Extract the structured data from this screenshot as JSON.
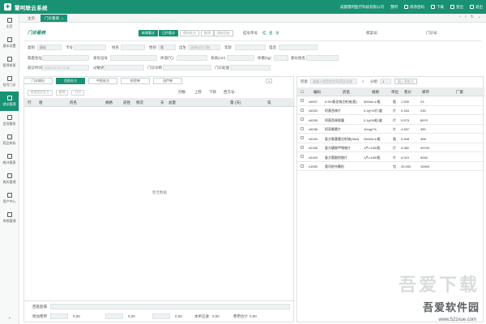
{
  "app": {
    "name": "慧呵联云系统"
  },
  "topbar": {
    "clinic": "成都慧呵医疗科技有限公司",
    "user": "慧呵",
    "modify_pwd": "修改密码",
    "download": "下载",
    "logout": "登出",
    "unread": "退出"
  },
  "sidebar": {
    "items": [
      {
        "label": "主页",
        "icon": "home-icon"
      },
      {
        "label": "基本设置",
        "icon": "gear-icon"
      },
      {
        "label": "医师排班",
        "icon": "calendar-icon"
      },
      {
        "label": "挂号门诊",
        "icon": "clipboard-icon"
      },
      {
        "label": "就诊管理",
        "icon": "person-icon"
      },
      {
        "label": "会员服务",
        "icon": "user-group-icon"
      },
      {
        "label": "药品库存",
        "icon": "pill-icon"
      },
      {
        "label": "统计报表",
        "icon": "chart-icon"
      },
      {
        "label": "病历管理",
        "icon": "folder-icon"
      },
      {
        "label": "用户中心",
        "icon": "user-icon"
      },
      {
        "label": "系统管理",
        "icon": "monitor-icon"
      }
    ],
    "collapse": "»"
  },
  "tabs": [
    {
      "label": "主页"
    },
    {
      "label": "门诊看病"
    }
  ],
  "header": {
    "title": "门诊看病",
    "buttons": [
      "新增看诊",
      "已约看诊",
      "保存处方",
      "取消",
      "保存历史"
    ],
    "reg_no_label": "挂号单号",
    "reg_btn": "挂",
    "query": "查",
    "visit_label": "访",
    "pat_no_label": "病案号:",
    "outpatient_no_label": "门诊号:"
  },
  "form": {
    "type_label": "类别",
    "type_value": "初诊",
    "card_label": "卡号",
    "name_label": "姓名",
    "gender_label": "性别",
    "gender_value": "男",
    "birth_label": "出生",
    "birth_placeholder": "选择出生日期",
    "age_label": "年龄",
    "phone_label": "电话",
    "addr_label": "家庭住址",
    "id_label": "身份证号",
    "temp_label": "体温(℃)",
    "height_label": "身高(cm)",
    "weight_label": "体重(kg)",
    "family_label": "家长姓名",
    "date_label": "就诊时间",
    "date_value": "2022-07-22 11:09",
    "history_label": "过敏史",
    "dept_label": "门诊诊断",
    "treat_label": "门诊处理"
  },
  "rx_tabs": [
    "门诊病历",
    "西医处方",
    "中医处方",
    "检验单",
    "治疗单"
  ],
  "rx_sub": {
    "btns": [
      "新增西药处方",
      "删除",
      "打印"
    ],
    "copies_label": "剂数",
    "up": "上移",
    "down": "下移",
    "rx_no_label": "西方号:"
  },
  "left_table": {
    "columns": [
      "行",
      "组",
      "药名",
      "规格",
      "途径",
      "频次",
      "天",
      "总量",
      "量",
      "(天)",
      "说"
    ],
    "empty": "暂无数据"
  },
  "left_footer": {
    "wm_label": "西医医嘱",
    "extra_label": "附加费用",
    "extra_value": "0.00",
    "v2": "0.00",
    "v3": "0.00",
    "fee_label": "本单应收",
    "fee_value": "0.00",
    "total_label": "费用合计",
    "total_value": "0.00"
  },
  "right_search": {
    "label": "检索",
    "placeholder": "请输入拼音首字母/药品名称",
    "count_label": "分组",
    "count_value": "1",
    "add_btn": "插入到处方"
  },
  "right_table": {
    "columns": [
      "",
      "编码",
      "药名",
      "规格",
      "单位",
      "售价",
      "库存",
      "厂家"
    ],
    "rows": [
      {
        "code": "x0007",
        "name": "0.9%氯化钠注射液(瓶)",
        "spec": "500ml×1/瓶",
        "unit": "瓶",
        "price": "1.530",
        "stock": "23"
      },
      {
        "code": "x0020",
        "name": "阿莫西林片",
        "spec": "0.2g*10片/盒",
        "unit": "片",
        "price": "0.154",
        "stock": "230"
      },
      {
        "code": "x0035",
        "name": "阿莫西林胶囊",
        "spec": "0.1g*50粒/盒",
        "unit": "片",
        "price": "0.575",
        "stock": "8970"
      },
      {
        "code": "x0038",
        "name": "阿奇霉素片",
        "spec": "10mg*7s",
        "unit": "片",
        "price": "4.457",
        "stock": "350"
      },
      {
        "code": "x0140",
        "name": "复方氨基酸注射液(3AA)",
        "spec": "250ml×1/瓶",
        "unit": "瓶",
        "price": "5.348",
        "stock": "398"
      },
      {
        "code": "x0155",
        "name": "复方磺胺甲噁唑片",
        "spec": "1片×100/瓶",
        "unit": "片",
        "price": "0.082",
        "stock": "49700"
      },
      {
        "code": "x0163",
        "name": "复方氨酚烷胺片",
        "spec": "1片×100/瓶",
        "unit": "片",
        "price": "0.010",
        "stock": "5000"
      },
      {
        "code": "x1050",
        "name": "奥司他韦颗粒",
        "spec": "",
        "unit": "包",
        "price": "20.000",
        "stock": "10000"
      }
    ]
  },
  "watermark": {
    "big": "吾爱下载",
    "text": "吾爱软件园",
    "url": "www.52zxue.com"
  }
}
